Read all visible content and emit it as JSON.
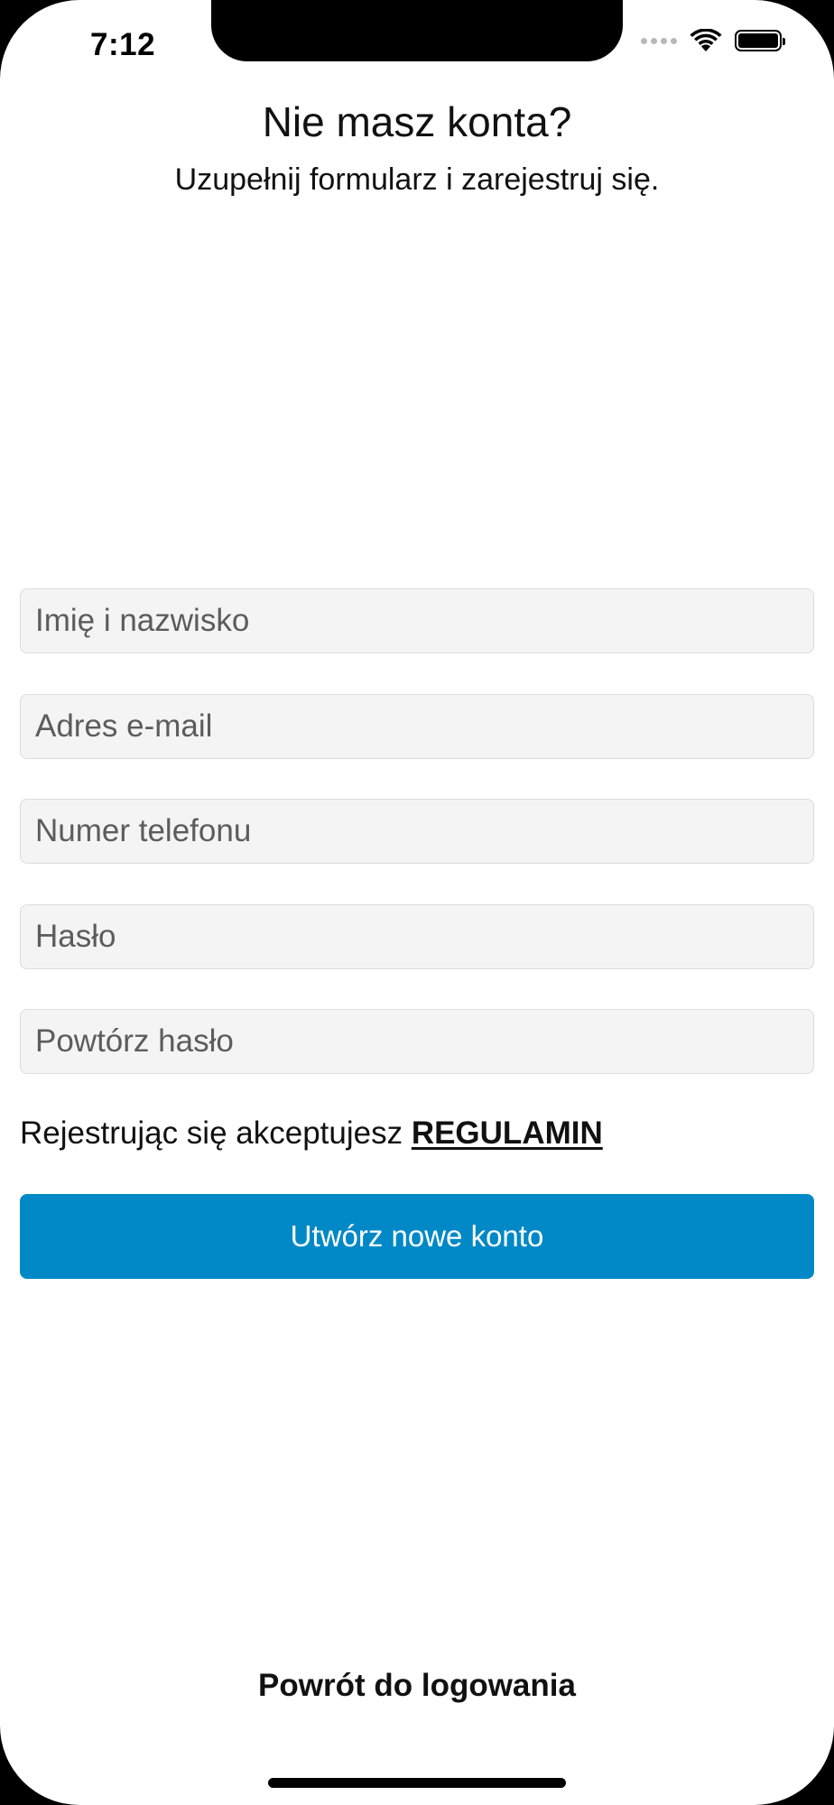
{
  "status_bar": {
    "time": "7:12",
    "icons": [
      "signal-dots-icon",
      "wifi-icon",
      "battery-icon"
    ]
  },
  "header": {
    "title": "Nie masz konta?",
    "subtitle": "Uzupełnij formularz i zarejestruj się."
  },
  "form": {
    "fields": [
      {
        "placeholder": "Imię i nazwisko",
        "value": ""
      },
      {
        "placeholder": "Adres e-mail",
        "value": ""
      },
      {
        "placeholder": "Numer telefonu",
        "value": ""
      },
      {
        "placeholder": "Hasło",
        "value": ""
      },
      {
        "placeholder": "Powtórz hasło",
        "value": ""
      }
    ],
    "terms_text": "Rejestrując się akceptujesz ",
    "terms_link": "REGULAMIN",
    "submit_label": "Utwórz nowe konto"
  },
  "footer": {
    "back_label": "Powrót do logowania"
  },
  "colors": {
    "accent": "#0089c6",
    "field_background": "#f4f4f4",
    "text": "#111111"
  }
}
